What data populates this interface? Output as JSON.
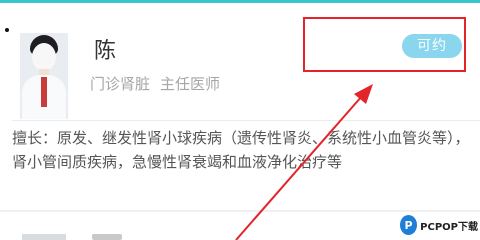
{
  "doctor": {
    "name": "陈",
    "department": "门诊肾脏",
    "title": "主任医师",
    "badge": "可约",
    "specialty": "擅长：原发、继发性肾小球疾病（遗传性肾炎、系统性小血管炎等），肾小管间质疾病，急慢性肾衰竭和血液净化治疗等"
  },
  "watermark": {
    "logo": "P",
    "text": "PCPOP下载"
  },
  "colors": {
    "accent": "#37c6cf",
    "badge": "#8ad6ee",
    "annotation": "#e3242b"
  },
  "icons": {
    "avatar": "doctor-photo"
  }
}
